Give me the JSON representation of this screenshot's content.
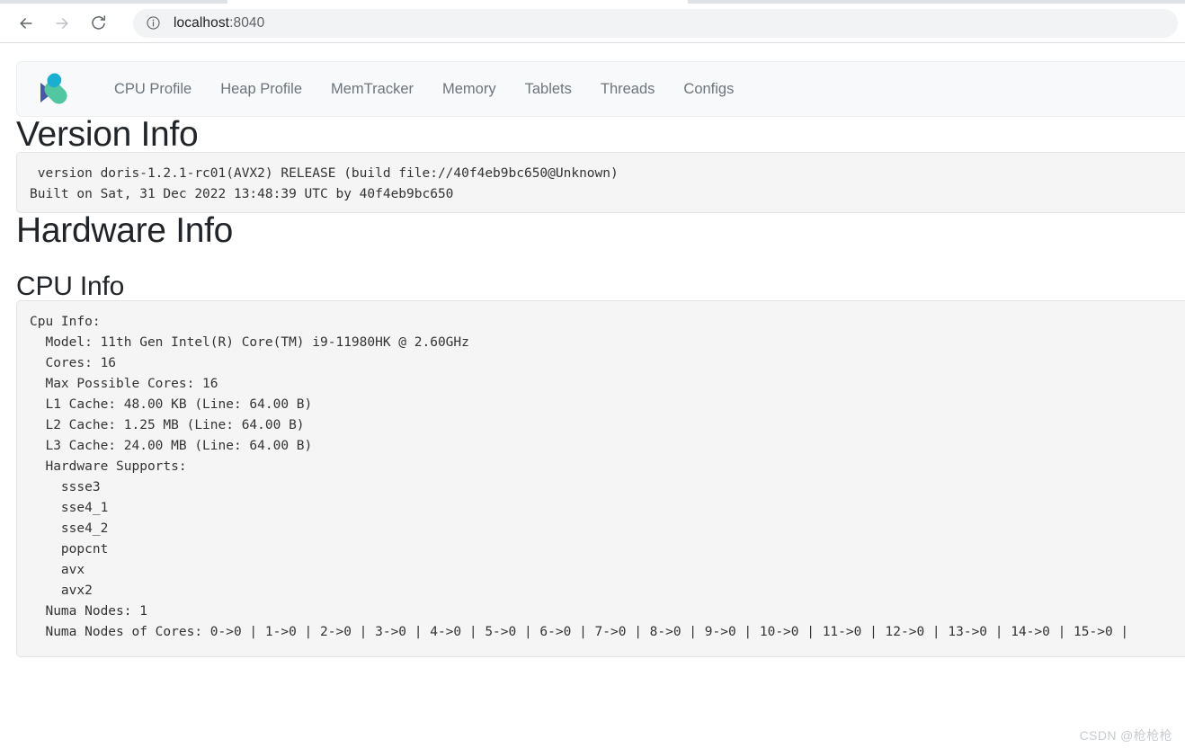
{
  "browser": {
    "back_label": "back-arrow",
    "forward_label": "forward-arrow",
    "reload_label": "reload",
    "site_info_label": "site-information",
    "url_host": "localhost",
    "url_port": ":8040"
  },
  "navbar": {
    "brand_label": "Apache Doris",
    "brand_colors": {
      "cyan": "#1aafd0",
      "indigo": "#4a56a6",
      "teal": "#52c6a0"
    },
    "links": [
      {
        "label": "CPU Profile"
      },
      {
        "label": "Heap Profile"
      },
      {
        "label": "MemTracker"
      },
      {
        "label": "Memory"
      },
      {
        "label": "Tablets"
      },
      {
        "label": "Threads"
      },
      {
        "label": "Configs"
      }
    ]
  },
  "version_section": {
    "title": "Version Info",
    "text": " version doris-1.2.1-rc01(AVX2) RELEASE (build file://40f4eb9bc650@Unknown)\nBuilt on Sat, 31 Dec 2022 13:48:39 UTC by 40f4eb9bc650"
  },
  "hardware_section": {
    "title": "Hardware Info",
    "cpu_title": "CPU Info",
    "cpu_text": "Cpu Info:\n  Model: 11th Gen Intel(R) Core(TM) i9-11980HK @ 2.60GHz\n  Cores: 16\n  Max Possible Cores: 16\n  L1 Cache: 48.00 KB (Line: 64.00 B)\n  L2 Cache: 1.25 MB (Line: 64.00 B)\n  L3 Cache: 24.00 MB (Line: 64.00 B)\n  Hardware Supports:\n    ssse3\n    sse4_1\n    sse4_2\n    popcnt\n    avx\n    avx2\n  Numa Nodes: 1\n  Numa Nodes of Cores: 0->0 | 1->0 | 2->0 | 3->0 | 4->0 | 5->0 | 6->0 | 7->0 | 8->0 | 9->0 | 10->0 | 11->0 | 12->0 | 13->0 | 14->0 | 15->0 |"
  },
  "watermark": {
    "text": "CSDN @枪枪枪"
  }
}
